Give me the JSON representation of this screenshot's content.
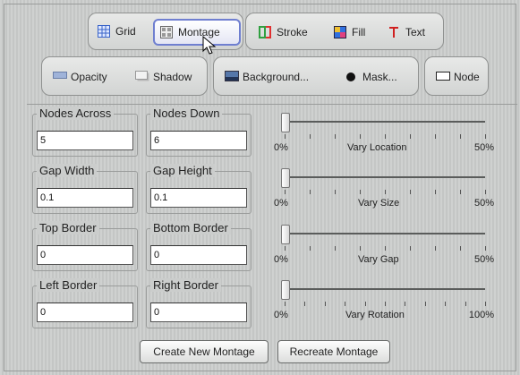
{
  "toolbar_row1": {
    "group_a": [
      {
        "label": "Grid",
        "icon": "grid-icon"
      },
      {
        "label": "Montage",
        "icon": "montage-icon",
        "selected": true
      }
    ],
    "group_b": [
      {
        "label": "Stroke",
        "icon": "stroke-icon"
      },
      {
        "label": "Fill",
        "icon": "fill-icon"
      },
      {
        "label": "Text",
        "icon": "text-icon"
      }
    ]
  },
  "toolbar_row2": {
    "group_a": [
      {
        "label": "Opacity",
        "icon": "opacity-icon"
      },
      {
        "label": "Shadow",
        "icon": "shadow-icon"
      }
    ],
    "group_b": [
      {
        "label": "Background...",
        "icon": "background-icon"
      },
      {
        "label": "Mask...",
        "icon": "mask-icon"
      }
    ],
    "node": {
      "label": "Node",
      "icon": "node-icon"
    }
  },
  "fields": {
    "nodes_across": {
      "label": "Nodes Across",
      "value": "5"
    },
    "nodes_down": {
      "label": "Nodes Down",
      "value": "6"
    },
    "gap_width": {
      "label": "Gap Width",
      "value": "0.1"
    },
    "gap_height": {
      "label": "Gap Height",
      "value": "0.1"
    },
    "top_border": {
      "label": "Top Border",
      "value": "0"
    },
    "bottom_border": {
      "label": "Bottom Border",
      "value": "0"
    },
    "left_border": {
      "label": "Left Border",
      "value": "0"
    },
    "right_border": {
      "label": "Right Border",
      "value": "0"
    }
  },
  "sliders": [
    {
      "name": "Vary Location",
      "min_label": "0%",
      "max_label": "50%",
      "value": 0
    },
    {
      "name": "Vary Size",
      "min_label": "0%",
      "max_label": "50%",
      "value": 0
    },
    {
      "name": "Vary Gap",
      "min_label": "0%",
      "max_label": "50%",
      "value": 0
    },
    {
      "name": "Vary Rotation",
      "min_label": "0%",
      "max_label": "100%",
      "value": 0
    }
  ],
  "actions": {
    "create": "Create New Montage",
    "recreate": "Recreate Montage"
  },
  "colors": {
    "selected_border": "#6f7fd0",
    "panel_background": "#c7c9c8"
  }
}
